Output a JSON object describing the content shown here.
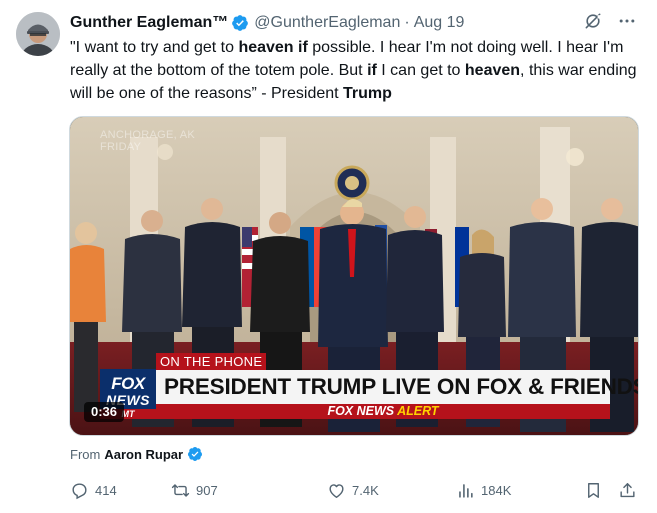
{
  "tweet": {
    "author": {
      "name": "Gunther Eagleman™",
      "handle": "@GuntherEagleman",
      "date": "Aug 19"
    },
    "text": {
      "p1": "\"I want to try and get to ",
      "b1": "heaven",
      "p2": " ",
      "b2": "if",
      "p3": " possible. I hear I'm not doing well. I hear I'm really at the bottom of the totem pole. But ",
      "b3": "if",
      "p4": " I can get to ",
      "b4": "heaven",
      "p5": ", this war ending will be one of the reasons” - President ",
      "b5": "Trump"
    },
    "media": {
      "watermark_line1": "ANCHORAGE, AK",
      "watermark_line2": "FRIDAY",
      "on_the_phone": "ON THE PHONE",
      "headline": "PRESIDENT TRUMP LIVE ON FOX & FRIENDS",
      "alert_brand": "FOX NEWS",
      "alert_word": "ALERT",
      "logo_line1": "FOX",
      "logo_line2": "NEWS",
      "logo_line3": "MT",
      "duration": "0:36"
    },
    "from": {
      "prefix": "From",
      "name": "Aaron Rupar"
    },
    "stats": {
      "replies": "414",
      "reposts": "907",
      "likes": "7.4K",
      "views": "184K"
    },
    "icons": {
      "verified": "verified-badge-icon",
      "grok": "grok-icon",
      "more": "more-icon",
      "reply": "reply-icon",
      "repost": "repost-icon",
      "like": "heart-icon",
      "views": "views-icon",
      "bookmark": "bookmark-icon",
      "share": "share-icon"
    },
    "colors": {
      "verified_blue": "#1d9bf0",
      "fox_red": "#b5121b",
      "fox_blue": "#0b2f6b",
      "muted": "#536471"
    }
  }
}
